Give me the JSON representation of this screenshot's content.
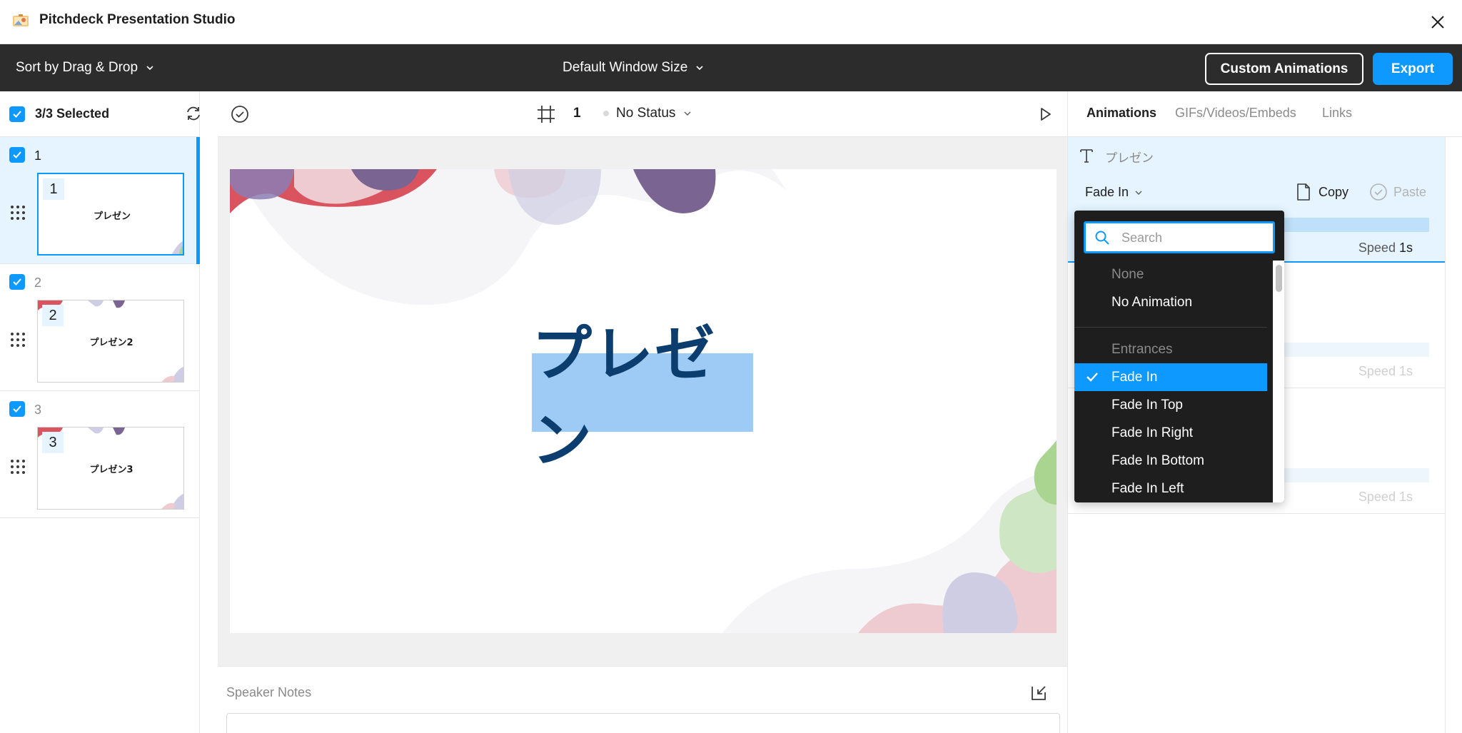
{
  "app": {
    "title": "Pitchdeck Presentation Studio"
  },
  "toolbar": {
    "sort_label": "Sort by Drag & Drop",
    "window_size_label": "Default Window Size",
    "custom_animations_label": "Custom Animations",
    "export_label": "Export"
  },
  "slides_panel": {
    "selected_label": "3/3 Selected",
    "slides": [
      {
        "number": "1",
        "thumb_number": "1",
        "title": "プレゼン",
        "checked": true,
        "active": true
      },
      {
        "number": "2",
        "thumb_number": "2",
        "title": "プレゼン2",
        "checked": true,
        "active": false
      },
      {
        "number": "3",
        "thumb_number": "3",
        "title": "プレゼン3",
        "checked": true,
        "active": false
      }
    ]
  },
  "canvas": {
    "frame_number": "1",
    "status_label": "No Status",
    "slide_text": "プレゼン",
    "speaker_notes_label": "Speaker Notes"
  },
  "right_panel": {
    "tabs": [
      "Animations",
      "GIFs/Videos/Embeds",
      "Links"
    ],
    "active_tab": "Animations",
    "element_name": "プレゼン",
    "animation_value": "Fade In",
    "copy_label": "Copy",
    "paste_label": "Paste",
    "speed_label": "Speed",
    "speed_value": "1s",
    "ghost_rows": [
      {
        "speed_label": "Speed",
        "speed_value": "1s"
      },
      {
        "speed_label": "Speed",
        "speed_value": "1s"
      }
    ]
  },
  "animation_dropdown": {
    "search_placeholder": "Search",
    "items": [
      {
        "label": "None",
        "type": "header"
      },
      {
        "label": "No Animation",
        "type": "option"
      },
      {
        "label": "Entrances",
        "type": "header"
      },
      {
        "label": "Fade In",
        "type": "option",
        "selected": true
      },
      {
        "label": "Fade In Top",
        "type": "option"
      },
      {
        "label": "Fade In Right",
        "type": "option"
      },
      {
        "label": "Fade In Bottom",
        "type": "option"
      },
      {
        "label": "Fade In Left",
        "type": "option"
      }
    ]
  },
  "colors": {
    "accent": "#0d99ff",
    "toolbar_bg": "#2c2c2c",
    "selected_row_bg": "#e5f4ff",
    "text_highlight": "#9ecbf6",
    "slide_text": "#0b3e6e",
    "blob_red": "#d9545e",
    "blob_purple": "#7a6592",
    "blob_lavender": "#cfcde3",
    "blob_pink": "#eecbd0",
    "blob_green": "#a9d590"
  },
  "icons": {
    "app": "app-logo-icon",
    "close": "close-icon",
    "chevron": "chevron-down-icon",
    "refresh": "refresh-icon",
    "drag": "drag-handle-icon",
    "check_circle": "check-circle-icon",
    "frame": "frame-grid-icon",
    "play": "play-icon",
    "export_notes": "export-notes-icon",
    "text": "text-icon",
    "copy": "copy-icon",
    "paste": "paste-icon",
    "search": "search-icon",
    "checkmark": "checkmark-icon"
  }
}
